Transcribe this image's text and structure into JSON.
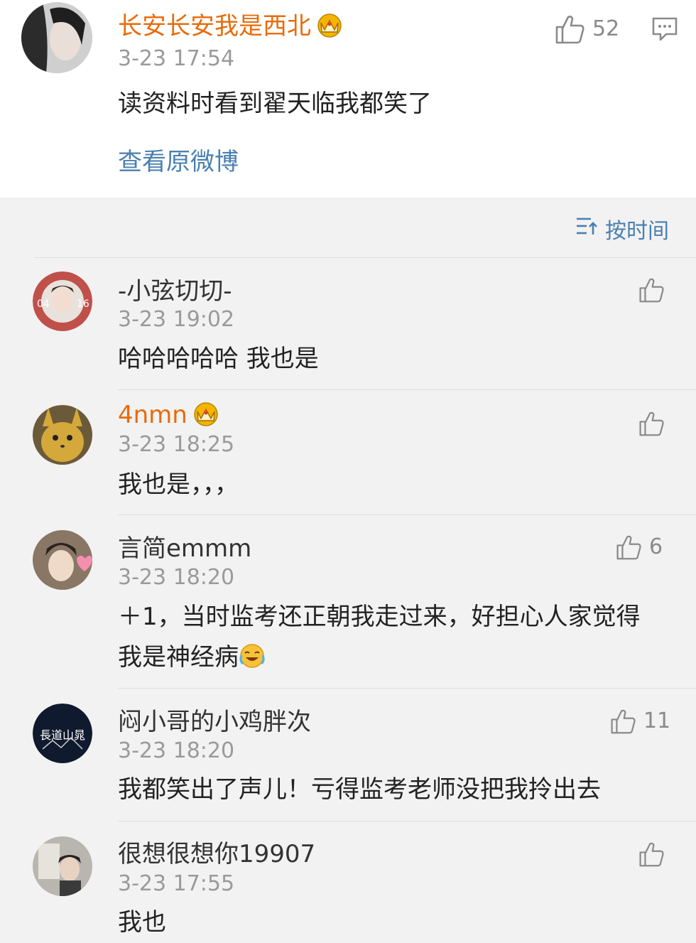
{
  "main_comment": {
    "username": "长安长安我是西北",
    "time": "3-23 17:54",
    "text": "读资料时看到翟天临我都笑了",
    "like_count": "52",
    "view_original": "查看原微博"
  },
  "sort": {
    "label": "按时间"
  },
  "replies": [
    {
      "username": "-小弦切切-",
      "time": "3-23 19:02",
      "text": "哈哈哈哈哈 我也是",
      "like_count": "",
      "avatar_text_left": "04",
      "avatar_text_right": "16"
    },
    {
      "username": "4nmn",
      "time": "3-23 18:25",
      "text": "我也是，，，",
      "like_count": ""
    },
    {
      "username": "言简emmm",
      "time": "3-23 18:20",
      "text": "＋1，当时监考还正朝我走过来，好担心人家觉得我是神经病",
      "like_count": "6"
    },
    {
      "username": "闷小哥的小鸡胖次",
      "time": "3-23 18:20",
      "text": "我都笑出了声儿！亏得监考老师没把我拎出去",
      "like_count": "11",
      "avatar_text": "長道山晁"
    },
    {
      "username": "很想很想你19907",
      "time": "3-23 17:55",
      "text": "我也",
      "like_count": ""
    }
  ],
  "colors": {
    "vip_name": "#e86b0a",
    "link": "#4a7fb0",
    "background": "#f2f2f2"
  }
}
